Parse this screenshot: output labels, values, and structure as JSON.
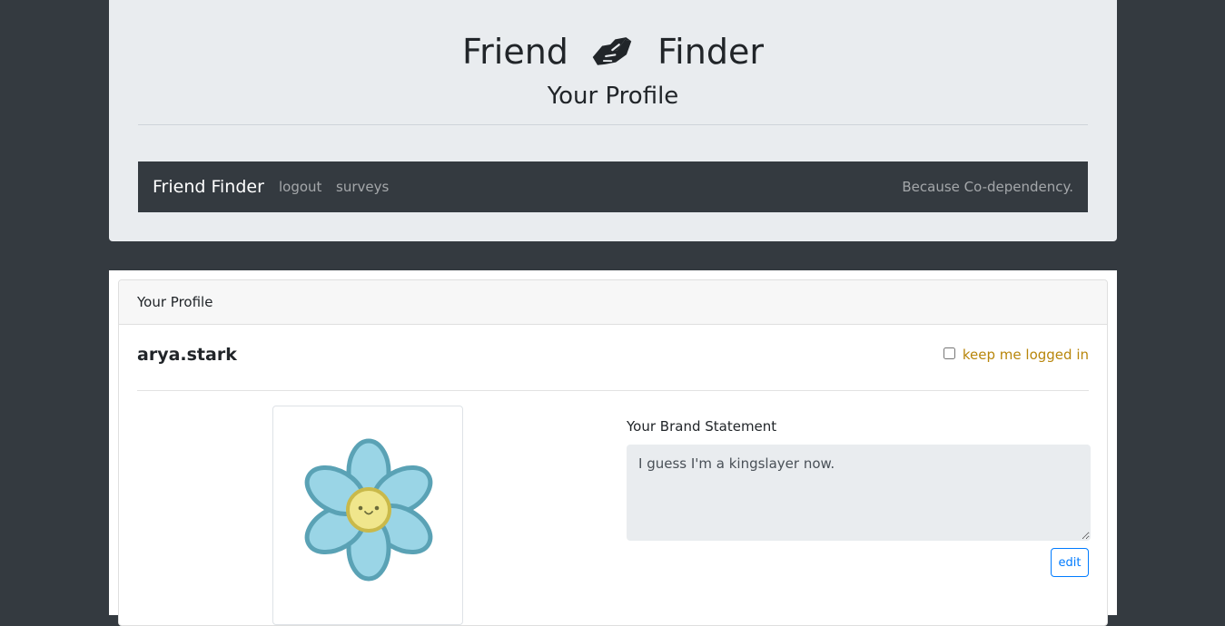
{
  "header": {
    "title_left": "Friend",
    "title_right": "Finder",
    "logo_icon": "handshake-icon",
    "subtitle": "Your Profile"
  },
  "navbar": {
    "brand": "Friend Finder",
    "links": [
      {
        "label": "logout"
      },
      {
        "label": "surveys"
      }
    ],
    "tagline": "Because Co-dependency."
  },
  "profile_card": {
    "header_title": "Your Profile",
    "username": "arya.stark",
    "keep_logged_in": {
      "label": "keep me logged in",
      "checked": false
    },
    "avatar_icon": "flower-avatar-icon",
    "brand_statement": {
      "label": "Your Brand Statement",
      "value": "I guess I'm a kingslayer now."
    },
    "edit_label": "edit"
  },
  "colors": {
    "page_background": "#343a40",
    "jumbotron": "#e9ecef",
    "navbar": "#343a40",
    "accent_gold": "#b8860b",
    "primary_blue": "#007bff",
    "flower_petal": "#9ad5e6",
    "flower_outline": "#5aa2b5",
    "flower_center": "#f0e68c"
  }
}
